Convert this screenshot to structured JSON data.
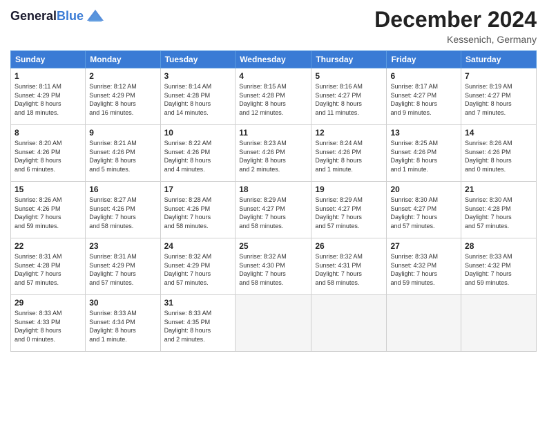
{
  "header": {
    "logo_line1": "General",
    "logo_line2": "Blue",
    "month_title": "December 2024",
    "location": "Kessenich, Germany"
  },
  "weekdays": [
    "Sunday",
    "Monday",
    "Tuesday",
    "Wednesday",
    "Thursday",
    "Friday",
    "Saturday"
  ],
  "days": [
    {
      "num": "",
      "info": ""
    },
    {
      "num": "",
      "info": ""
    },
    {
      "num": "",
      "info": ""
    },
    {
      "num": "",
      "info": ""
    },
    {
      "num": "",
      "info": ""
    },
    {
      "num": "",
      "info": ""
    },
    {
      "num": "",
      "info": ""
    },
    {
      "num": "1",
      "info": "Sunrise: 8:11 AM\nSunset: 4:29 PM\nDaylight: 8 hours\nand 18 minutes."
    },
    {
      "num": "2",
      "info": "Sunrise: 8:12 AM\nSunset: 4:29 PM\nDaylight: 8 hours\nand 16 minutes."
    },
    {
      "num": "3",
      "info": "Sunrise: 8:14 AM\nSunset: 4:28 PM\nDaylight: 8 hours\nand 14 minutes."
    },
    {
      "num": "4",
      "info": "Sunrise: 8:15 AM\nSunset: 4:28 PM\nDaylight: 8 hours\nand 12 minutes."
    },
    {
      "num": "5",
      "info": "Sunrise: 8:16 AM\nSunset: 4:27 PM\nDaylight: 8 hours\nand 11 minutes."
    },
    {
      "num": "6",
      "info": "Sunrise: 8:17 AM\nSunset: 4:27 PM\nDaylight: 8 hours\nand 9 minutes."
    },
    {
      "num": "7",
      "info": "Sunrise: 8:19 AM\nSunset: 4:27 PM\nDaylight: 8 hours\nand 7 minutes."
    },
    {
      "num": "8",
      "info": "Sunrise: 8:20 AM\nSunset: 4:26 PM\nDaylight: 8 hours\nand 6 minutes."
    },
    {
      "num": "9",
      "info": "Sunrise: 8:21 AM\nSunset: 4:26 PM\nDaylight: 8 hours\nand 5 minutes."
    },
    {
      "num": "10",
      "info": "Sunrise: 8:22 AM\nSunset: 4:26 PM\nDaylight: 8 hours\nand 4 minutes."
    },
    {
      "num": "11",
      "info": "Sunrise: 8:23 AM\nSunset: 4:26 PM\nDaylight: 8 hours\nand 2 minutes."
    },
    {
      "num": "12",
      "info": "Sunrise: 8:24 AM\nSunset: 4:26 PM\nDaylight: 8 hours\nand 1 minute."
    },
    {
      "num": "13",
      "info": "Sunrise: 8:25 AM\nSunset: 4:26 PM\nDaylight: 8 hours\nand 1 minute."
    },
    {
      "num": "14",
      "info": "Sunrise: 8:26 AM\nSunset: 4:26 PM\nDaylight: 8 hours\nand 0 minutes."
    },
    {
      "num": "15",
      "info": "Sunrise: 8:26 AM\nSunset: 4:26 PM\nDaylight: 7 hours\nand 59 minutes."
    },
    {
      "num": "16",
      "info": "Sunrise: 8:27 AM\nSunset: 4:26 PM\nDaylight: 7 hours\nand 58 minutes."
    },
    {
      "num": "17",
      "info": "Sunrise: 8:28 AM\nSunset: 4:26 PM\nDaylight: 7 hours\nand 58 minutes."
    },
    {
      "num": "18",
      "info": "Sunrise: 8:29 AM\nSunset: 4:27 PM\nDaylight: 7 hours\nand 58 minutes."
    },
    {
      "num": "19",
      "info": "Sunrise: 8:29 AM\nSunset: 4:27 PM\nDaylight: 7 hours\nand 57 minutes."
    },
    {
      "num": "20",
      "info": "Sunrise: 8:30 AM\nSunset: 4:27 PM\nDaylight: 7 hours\nand 57 minutes."
    },
    {
      "num": "21",
      "info": "Sunrise: 8:30 AM\nSunset: 4:28 PM\nDaylight: 7 hours\nand 57 minutes."
    },
    {
      "num": "22",
      "info": "Sunrise: 8:31 AM\nSunset: 4:28 PM\nDaylight: 7 hours\nand 57 minutes."
    },
    {
      "num": "23",
      "info": "Sunrise: 8:31 AM\nSunset: 4:29 PM\nDaylight: 7 hours\nand 57 minutes."
    },
    {
      "num": "24",
      "info": "Sunrise: 8:32 AM\nSunset: 4:29 PM\nDaylight: 7 hours\nand 57 minutes."
    },
    {
      "num": "25",
      "info": "Sunrise: 8:32 AM\nSunset: 4:30 PM\nDaylight: 7 hours\nand 58 minutes."
    },
    {
      "num": "26",
      "info": "Sunrise: 8:32 AM\nSunset: 4:31 PM\nDaylight: 7 hours\nand 58 minutes."
    },
    {
      "num": "27",
      "info": "Sunrise: 8:33 AM\nSunset: 4:32 PM\nDaylight: 7 hours\nand 59 minutes."
    },
    {
      "num": "28",
      "info": "Sunrise: 8:33 AM\nSunset: 4:32 PM\nDaylight: 7 hours\nand 59 minutes."
    },
    {
      "num": "29",
      "info": "Sunrise: 8:33 AM\nSunset: 4:33 PM\nDaylight: 8 hours\nand 0 minutes."
    },
    {
      "num": "30",
      "info": "Sunrise: 8:33 AM\nSunset: 4:34 PM\nDaylight: 8 hours\nand 1 minute."
    },
    {
      "num": "31",
      "info": "Sunrise: 8:33 AM\nSunset: 4:35 PM\nDaylight: 8 hours\nand 2 minutes."
    }
  ]
}
